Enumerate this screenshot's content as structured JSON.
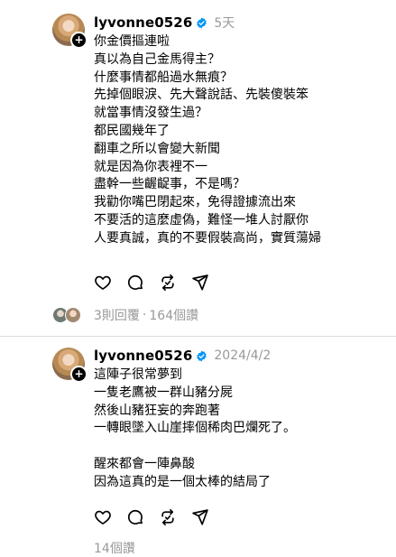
{
  "posts": [
    {
      "username": "lyvonne0526",
      "timestamp": "5天",
      "lines": [
        "你金價摳連啦",
        "真以為自己金馬得主？",
        "什麼事情都船過水無痕？",
        "先掉個眼淚、先大聲說話、先裝傻裝笨",
        "就當事情沒發生過？",
        "都民國幾年了",
        "翻車之所以會變大新聞",
        "就是因為你表裡不一",
        "盡幹一些齷齪事，不是嗎？",
        "我勸你嘴巴閉起來，免得證據流出來",
        "不要活的這麼虛偽，難怪一堆人討厭你",
        "人要真誠，真的不要假裝高尚，實質蕩婦"
      ],
      "stats": {
        "replies": "3則回覆",
        "separator": "·",
        "views": "164個讚"
      }
    },
    {
      "username": "lyvonne0526",
      "timestamp": "2024/4/2",
      "lines": [
        "這陣子很常夢到",
        "一隻老鷹被一群山豬分屍",
        "然後山豬狂妄的奔跑著",
        "一轉眼墜入山崖摔個稀肉巴爛死了。",
        "",
        "醒來都會一陣鼻酸",
        "因為這真的是一個太棒的結局了"
      ],
      "stats": {
        "views": "14個讚"
      }
    }
  ],
  "icons": {
    "like": "heart-icon",
    "comment": "comment-icon",
    "repost": "repost-icon",
    "share": "share-icon",
    "verified": "verified-badge-icon",
    "follow": "plus-icon"
  },
  "colors": {
    "verified": "#0095f6",
    "secondary_text": "#999999",
    "divider": "#dbdbdb"
  }
}
